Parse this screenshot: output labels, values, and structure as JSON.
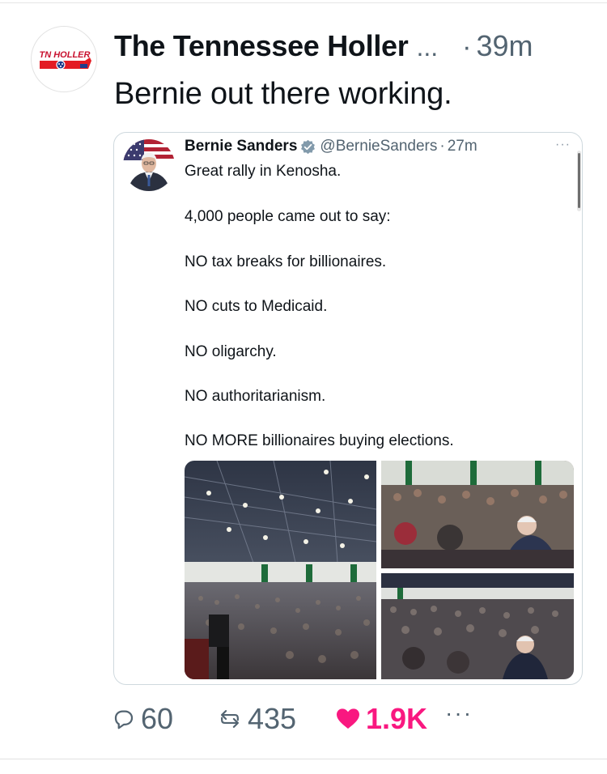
{
  "post": {
    "author": {
      "display_name": "The Tennessee Holler",
      "name_truncation": "...",
      "avatar_text": "TN HOLLER",
      "avatar_icon": "tennessee-state-logo"
    },
    "separator": "·",
    "time": "39m",
    "text": "Bernie out there working."
  },
  "quote": {
    "author": {
      "display_name": "Bernie Sanders",
      "handle": "@BernieSanders",
      "verified_icon": "verified-badge-icon",
      "avatar_icon": "profile-photo"
    },
    "separator": "·",
    "time": "27m",
    "more_icon": "···",
    "lines": [
      "Great rally in Kenosha.",
      "4,000 people came out to say:",
      "NO tax breaks for billionaires.",
      "NO cuts to Medicaid.",
      "NO oligarchy.",
      "NO authoritarianism.",
      "NO MORE billionaires buying elections."
    ],
    "photos": [
      "rally-arena-wide-photo",
      "crowd-handshake-photo",
      "crowd-greeting-photo"
    ]
  },
  "actions": {
    "replies": "60",
    "reposts": "435",
    "likes": "1.9K",
    "more": "···"
  },
  "colors": {
    "like": "#f91880",
    "muted": "#536471",
    "text": "#0f1419",
    "verified": "#829aab",
    "card_border": "#cfd9de"
  }
}
